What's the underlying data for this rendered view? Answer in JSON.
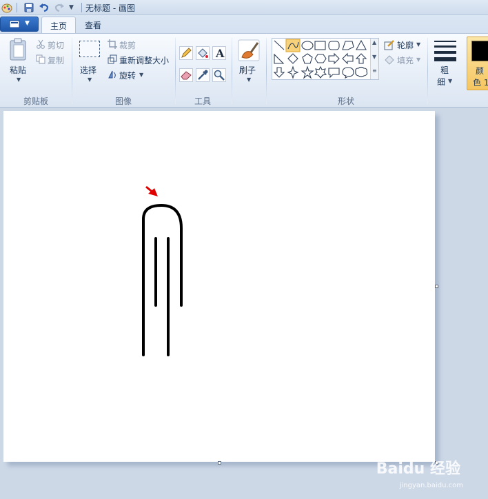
{
  "window": {
    "title": "无标题 - 画图"
  },
  "tabs": [
    {
      "label": "主页"
    },
    {
      "label": "查看"
    }
  ],
  "clipboard": {
    "paste": "粘贴",
    "cut": "剪切",
    "copy": "复制",
    "group": "剪贴板"
  },
  "image": {
    "select": "选择",
    "crop": "裁剪",
    "resize": "重新调整大小",
    "rotate": "旋转",
    "group": "图像"
  },
  "tools": {
    "group": "工具"
  },
  "brushes": {
    "label": "刷子"
  },
  "shapes": {
    "group": "形状",
    "outline": "轮廓",
    "fill": "填充"
  },
  "size": {
    "label_line1": "粗",
    "label_line2": "细"
  },
  "color": {
    "label_line1": "颜",
    "label_line2": "色 1",
    "value": "#000000"
  },
  "watermark": {
    "brand": "Baidu 经验",
    "url": "jingyan.baidu.com"
  },
  "accent": {
    "active_tool": "#f8d27a",
    "app_menu": "#2d6bc4"
  }
}
